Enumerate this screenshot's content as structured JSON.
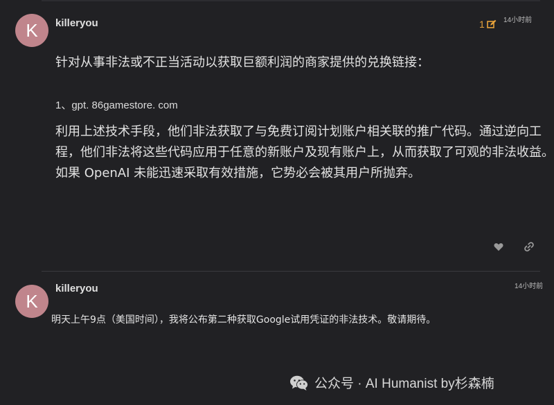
{
  "posts": [
    {
      "avatar_letter": "K",
      "username": "killeryou",
      "edit_count": "1",
      "timestamp": "14小时前",
      "intro": "针对从事非法或不正当活动以获取巨额利润的商家提供的兑换链接：",
      "link": "1、gpt. 86gamestore. com",
      "body": "利用上述技术手段，他们非法获取了与免费订阅计划账户相关联的推广代码。通过逆向工程，他们非法将这些代码应用于任意的新账户及现有账户上，从而获取了可观的非法收益。如果 OpenAI 未能迅速采取有效措施，它势必会被其用户所抛弃。",
      "actions": [
        "heart-icon",
        "link-icon"
      ]
    },
    {
      "avatar_letter": "K",
      "username": "killeryou",
      "timestamp": "14小时前",
      "body": "明天上午9点（美国时间），我将公布第二种获取Google试用凭证的非法技术。敬请期待。"
    }
  ],
  "watermark": {
    "text": "公众号 · AI Humanist by杉森楠"
  },
  "colors": {
    "background": "#212124",
    "avatar": "#c0858c",
    "edit_accent": "#e8a33b"
  }
}
